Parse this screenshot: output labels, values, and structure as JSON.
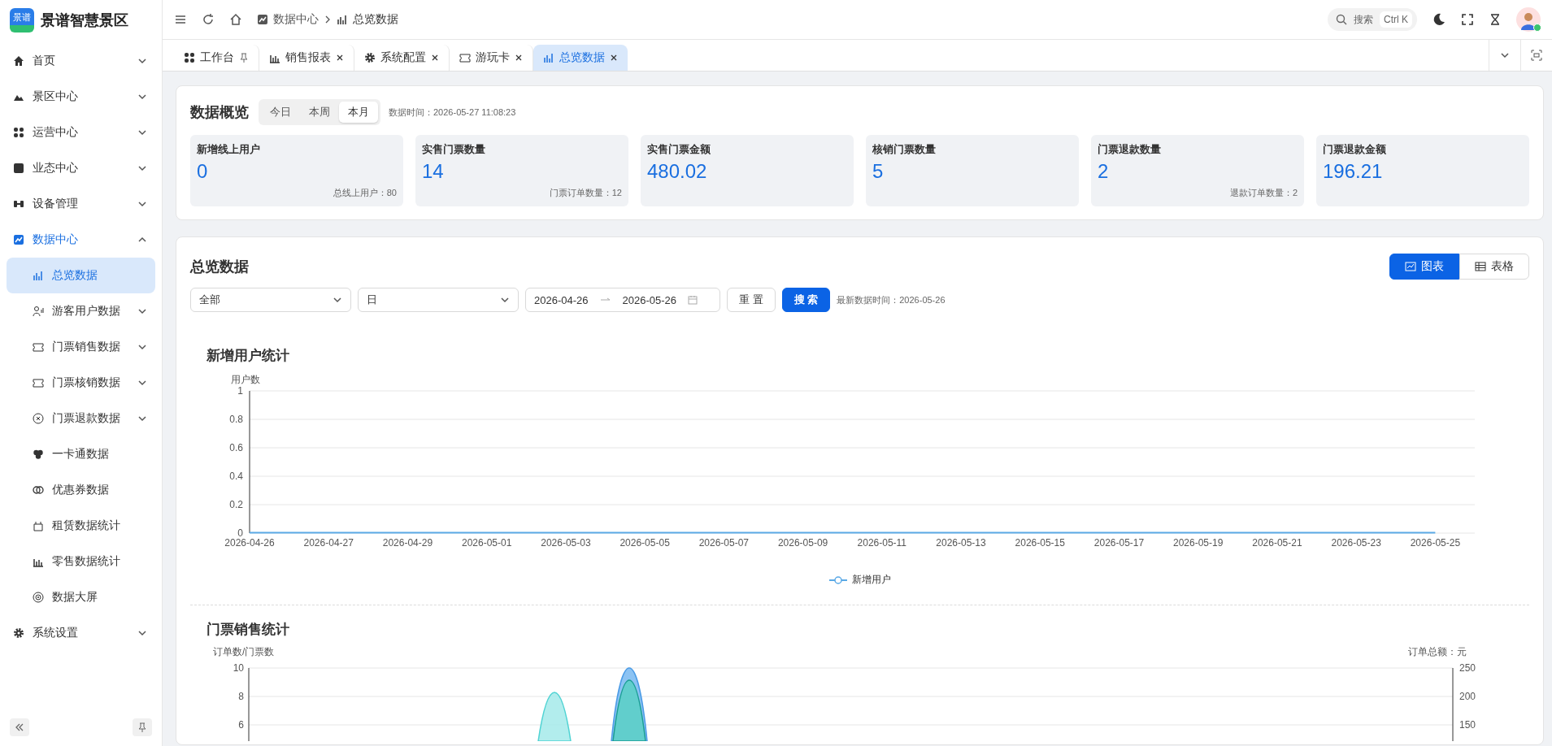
{
  "brand": {
    "logo_text": "景谱",
    "name": "景谱智慧景区"
  },
  "sidebar": {
    "items": [
      {
        "label": "首页",
        "expandable": true,
        "expanded": false,
        "selected": false
      },
      {
        "label": "景区中心",
        "expandable": true,
        "expanded": false,
        "selected": false
      },
      {
        "label": "运营中心",
        "expandable": true,
        "expanded": false,
        "selected": false
      },
      {
        "label": "业态中心",
        "expandable": true,
        "expanded": false,
        "selected": false
      },
      {
        "label": "设备管理",
        "expandable": true,
        "expanded": false,
        "selected": false
      },
      {
        "label": "数据中心",
        "expandable": true,
        "expanded": true,
        "selected": true,
        "children": [
          {
            "label": "总览数据",
            "expandable": false,
            "selected": true
          },
          {
            "label": "游客用户数据",
            "expandable": true,
            "selected": false
          },
          {
            "label": "门票销售数据",
            "expandable": true,
            "selected": false
          },
          {
            "label": "门票核销数据",
            "expandable": true,
            "selected": false
          },
          {
            "label": "门票退款数据",
            "expandable": true,
            "selected": false
          },
          {
            "label": "一卡通数据",
            "expandable": false,
            "selected": false
          },
          {
            "label": "优惠券数据",
            "expandable": false,
            "selected": false
          },
          {
            "label": "租赁数据统计",
            "expandable": false,
            "selected": false
          },
          {
            "label": "零售数据统计",
            "expandable": false,
            "selected": false
          },
          {
            "label": "数据大屏",
            "expandable": false,
            "selected": false
          }
        ]
      },
      {
        "label": "系统设置",
        "expandable": true,
        "expanded": false,
        "selected": false
      }
    ]
  },
  "header": {
    "breadcrumb": [
      "数据中心",
      "总览数据"
    ],
    "search": {
      "placeholder": "搜索",
      "shortcut": "Ctrl K"
    },
    "user_online": true
  },
  "tabs": [
    {
      "label": "工作台",
      "pinned": true,
      "selected": false
    },
    {
      "label": "销售报表",
      "pinned": false,
      "selected": false
    },
    {
      "label": "系统配置",
      "pinned": false,
      "selected": false
    },
    {
      "label": "游玩卡",
      "pinned": false,
      "selected": false
    },
    {
      "label": "总览数据",
      "pinned": false,
      "selected": true
    }
  ],
  "overview": {
    "title": "数据概览",
    "periods": [
      {
        "label": "今日",
        "selected": false
      },
      {
        "label": "本周",
        "selected": false
      },
      {
        "label": "本月",
        "selected": true
      }
    ],
    "timestamp": "数据时间：2026-05-27 11:08:23",
    "stats": [
      {
        "label": "新增线上用户",
        "value": "0",
        "note": "总线上用户：80"
      },
      {
        "label": "实售门票数量",
        "value": "14",
        "note": "门票订单数量：12"
      },
      {
        "label": "实售门票金额",
        "value": "480.02"
      },
      {
        "label": "核销门票数量",
        "value": "5"
      },
      {
        "label": "门票退款数量",
        "value": "2",
        "note": "退款订单数量：2"
      },
      {
        "label": "门票退款金额",
        "value": "196.21"
      }
    ]
  },
  "details": {
    "title": "总览数据",
    "views": [
      {
        "label": "图表",
        "selected": true
      },
      {
        "label": "表格",
        "selected": false
      }
    ],
    "filters": {
      "scope": "全部",
      "granularity": "日",
      "date_start": "2026-04-26",
      "date_end": "2026-05-26"
    },
    "buttons": [
      "重 置",
      "搜 索"
    ],
    "latest_time": "最新数据时间：2026-05-26",
    "user_chart": {
      "title": "新增用户统计",
      "chart_data": {
        "type": "line",
        "ylabel": "用户数",
        "categories": [
          "2026-04-26",
          "2026-04-27",
          "2026-04-29",
          "2026-05-01",
          "2026-05-03",
          "2026-05-05",
          "2026-05-07",
          "2026-05-09",
          "2026-05-11",
          "2026-05-13",
          "2026-05-15",
          "2026-05-17",
          "2026-05-19",
          "2026-05-21",
          "2026-05-23",
          "2026-05-25"
        ],
        "series": [
          {
            "name": "新增用户",
            "color": "#5aa9e6",
            "values": [
              0,
              0,
              0,
              0,
              0,
              0,
              0,
              0,
              0,
              0,
              0,
              0,
              0,
              0,
              0,
              0
            ]
          }
        ],
        "ylim": [
          0,
          1
        ],
        "yticks": [
          0,
          0.2,
          0.4,
          0.6,
          0.8,
          1
        ],
        "grid": true
      }
    },
    "sales_chart": {
      "title": "门票销售统计",
      "left_axis_label": "订单数/门票数",
      "right_axis_label": "订单总额：元",
      "left_ticks": [
        "10",
        "8",
        "6"
      ],
      "right_ticks": [
        "250",
        "200",
        "150"
      ]
    }
  }
}
